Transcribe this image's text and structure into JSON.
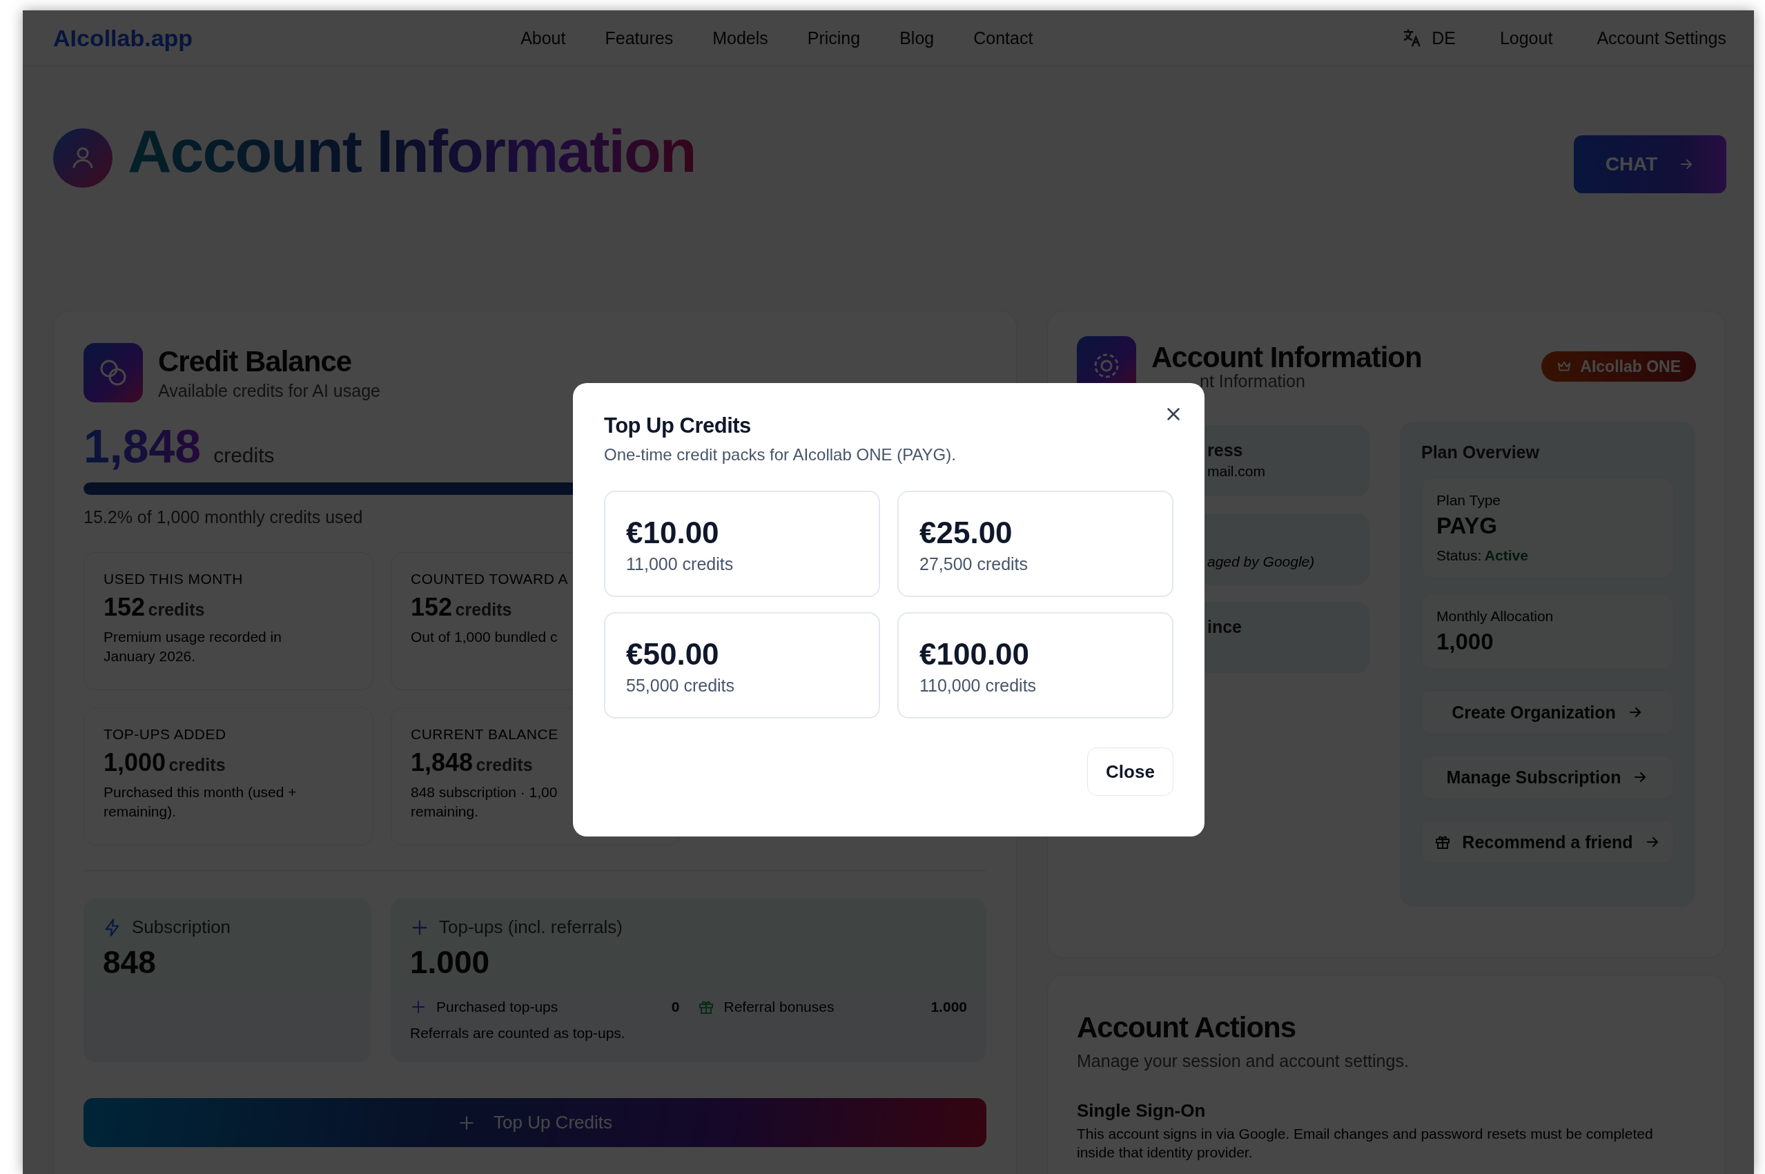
{
  "nav": {
    "logo": "AIcollab.app",
    "links": [
      "About",
      "Features",
      "Models",
      "Pricing",
      "Blog",
      "Contact"
    ],
    "language": "DE",
    "logout": "Logout",
    "account_settings": "Account Settings"
  },
  "header": {
    "title": "Account Information",
    "chat_button": "CHAT"
  },
  "credit_balance": {
    "title": "Credit Balance",
    "subtitle": "Available credits for AI usage",
    "amount": "1,848",
    "unit": "credits",
    "usage": {
      "level": 0.85
    },
    "usage_text": "15.2% of 1,000 monthly credits used",
    "stats": [
      {
        "label": "USED THIS MONTH",
        "value": "152",
        "unit": "credits",
        "note": "Premium usage recorded in\nJanuary 2026."
      },
      {
        "label": "COUNTED TOWARD A",
        "value": "152",
        "unit": "credits",
        "note": "Out of 1,000 bundled c"
      },
      {
        "label": "TOP-UPS ADDED",
        "value": "1,000",
        "unit": "credits",
        "note": "Purchased this month (used +\nremaining)."
      },
      {
        "label": "CURRENT BALANCE",
        "value": "1,848",
        "unit": "credits",
        "note": "848 subscription · 1,00\nremaining."
      }
    ],
    "subscription": {
      "label": "Subscription",
      "value": "848"
    },
    "topups": {
      "label": "Top-ups (incl. referrals)",
      "value": "1.000",
      "purchased_label": "Purchased top-ups",
      "purchased_value": "0",
      "referral_label": "Referral bonuses",
      "referral_value": "1.000",
      "note": "Referrals are counted as top-ups."
    },
    "top_up_button": "Top Up Credits"
  },
  "account_info": {
    "title": "Account Information",
    "subtitle": "nt Information",
    "badge": "AIcollab ONE",
    "fields": [
      {
        "label": "ress",
        "value": "mail.com"
      },
      {
        "value": "aged by Google)"
      },
      {
        "label": "ince"
      }
    ],
    "plan_overview": {
      "title": "Plan Overview",
      "plan_type_label": "Plan Type",
      "plan_type": "PAYG",
      "status_label": "Status:",
      "status": "Active",
      "allocation_label": "Monthly Allocation",
      "allocation": "1,000",
      "actions": [
        {
          "label": "Create Organization",
          "kind": "plain"
        },
        {
          "label": "Manage Subscription",
          "kind": "plain"
        },
        {
          "label": "Recommend a friend",
          "kind": "gift"
        }
      ]
    }
  },
  "account_actions": {
    "title": "Account Actions",
    "subtitle": "Manage your session and account settings.",
    "sso_title": "Single Sign-On",
    "sso_text": "This account signs in via Google. Email changes and password resets must be completed inside that identity provider."
  },
  "modal": {
    "title": "Top Up Credits",
    "subtitle": "One-time credit packs for AIcollab ONE (PAYG).",
    "packs": [
      {
        "price": "€10.00",
        "credits": "11,000 credits"
      },
      {
        "price": "€25.00",
        "credits": "27,500 credits"
      },
      {
        "price": "€50.00",
        "credits": "55,000 credits"
      },
      {
        "price": "€100.00",
        "credits": "110,000 credits"
      }
    ],
    "close_button": "Close"
  }
}
